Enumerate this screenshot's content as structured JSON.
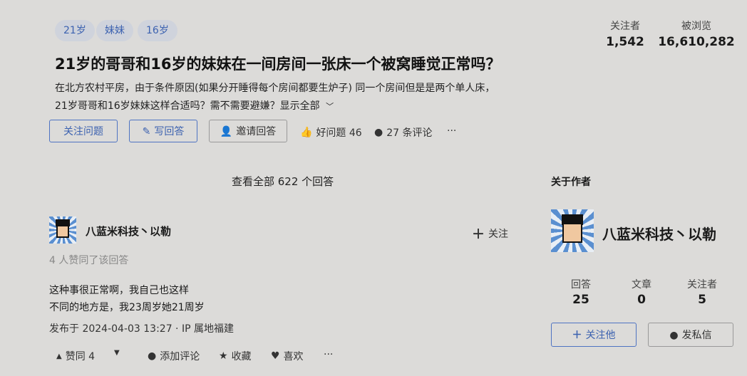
{
  "tags": [
    "21岁",
    "妹妹",
    "16岁"
  ],
  "stats": {
    "followers_label": "关注者",
    "followers": "1,542",
    "views_label": "被浏览",
    "views": "16,610,282"
  },
  "question": {
    "title": "21岁的哥哥和16岁的妹妹在一间房间一张床一个被窝睡觉正常吗？",
    "desc_line1": "在北方农村平房，由于条件原因(如果分开睡得每个房间都要生炉子) 同一个房间但是是两个单人床，",
    "desc_line2": "21岁哥哥和16岁妹妹这样合适吗？需不需要避嫌？",
    "show_all": "显示全部"
  },
  "actions": {
    "follow_question": "关注问题",
    "write_answer": "写回答",
    "invite": "邀请回答",
    "good_question": "好问题 46",
    "comments": "27 条评论",
    "more": "···"
  },
  "answers": {
    "view_all": "查看全部 622 个回答"
  },
  "answer": {
    "author": "八蓝米科技丶以勒",
    "follow": "关注",
    "upvote_note": "4 人赞同了该回答",
    "body_line1": "这种事很正常啊，我自己也这样",
    "body_line2": "不同的地方是，我23周岁她21周岁",
    "published": "发布于 2024-04-03 13:27 · IP 属地福建",
    "vote": "赞同 4",
    "add_comment": "添加评论",
    "favorite": "收藏",
    "like": "喜欢",
    "more": "···"
  },
  "author_card": {
    "heading": "关于作者",
    "name": "八蓝米科技丶以勒",
    "answers_label": "回答",
    "answers": "25",
    "articles_label": "文章",
    "articles": "0",
    "followers_label": "关注者",
    "followers": "5",
    "follow_btn": "关注他",
    "message_btn": "发私信"
  },
  "colors": {
    "accent": "#3c62b0",
    "background": "#dcdbd9"
  }
}
